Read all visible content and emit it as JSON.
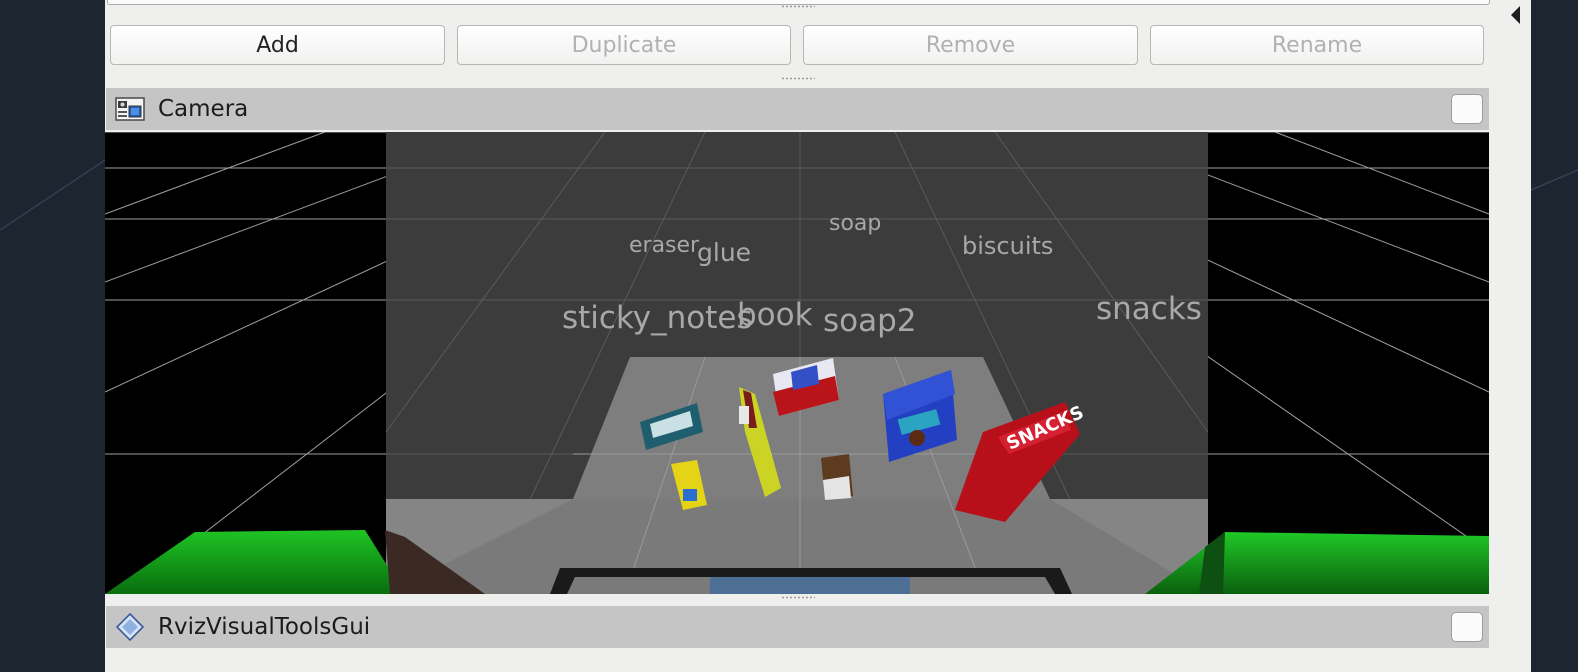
{
  "toolbar": {
    "add_label": "Add",
    "duplicate_label": "Duplicate",
    "remove_label": "Remove",
    "rename_label": "Rename"
  },
  "camera_panel": {
    "title": "Camera",
    "icon": "camera-display-icon"
  },
  "viewport": {
    "object_labels": {
      "eraser": "eraser",
      "glue": "glue",
      "soap": "soap",
      "biscuits": "biscuits",
      "sticky_notes": "sticky_notes",
      "book": "book",
      "soap2": "soap2",
      "snacks": "snacks"
    },
    "product_text": {
      "snacks_box": "SNACKS"
    },
    "colors": {
      "background": "#000000",
      "table": "#7a7a7a",
      "bin": "#16b21a",
      "grid": "#a0a0a0"
    }
  },
  "tools_panel": {
    "title": "RvizVisualToolsGui",
    "icon": "diamond-icon"
  },
  "colors": {
    "panel_bg": "#efefed",
    "title_bar": "#c5c5c5",
    "disabled_text": "#b1b1b1"
  }
}
